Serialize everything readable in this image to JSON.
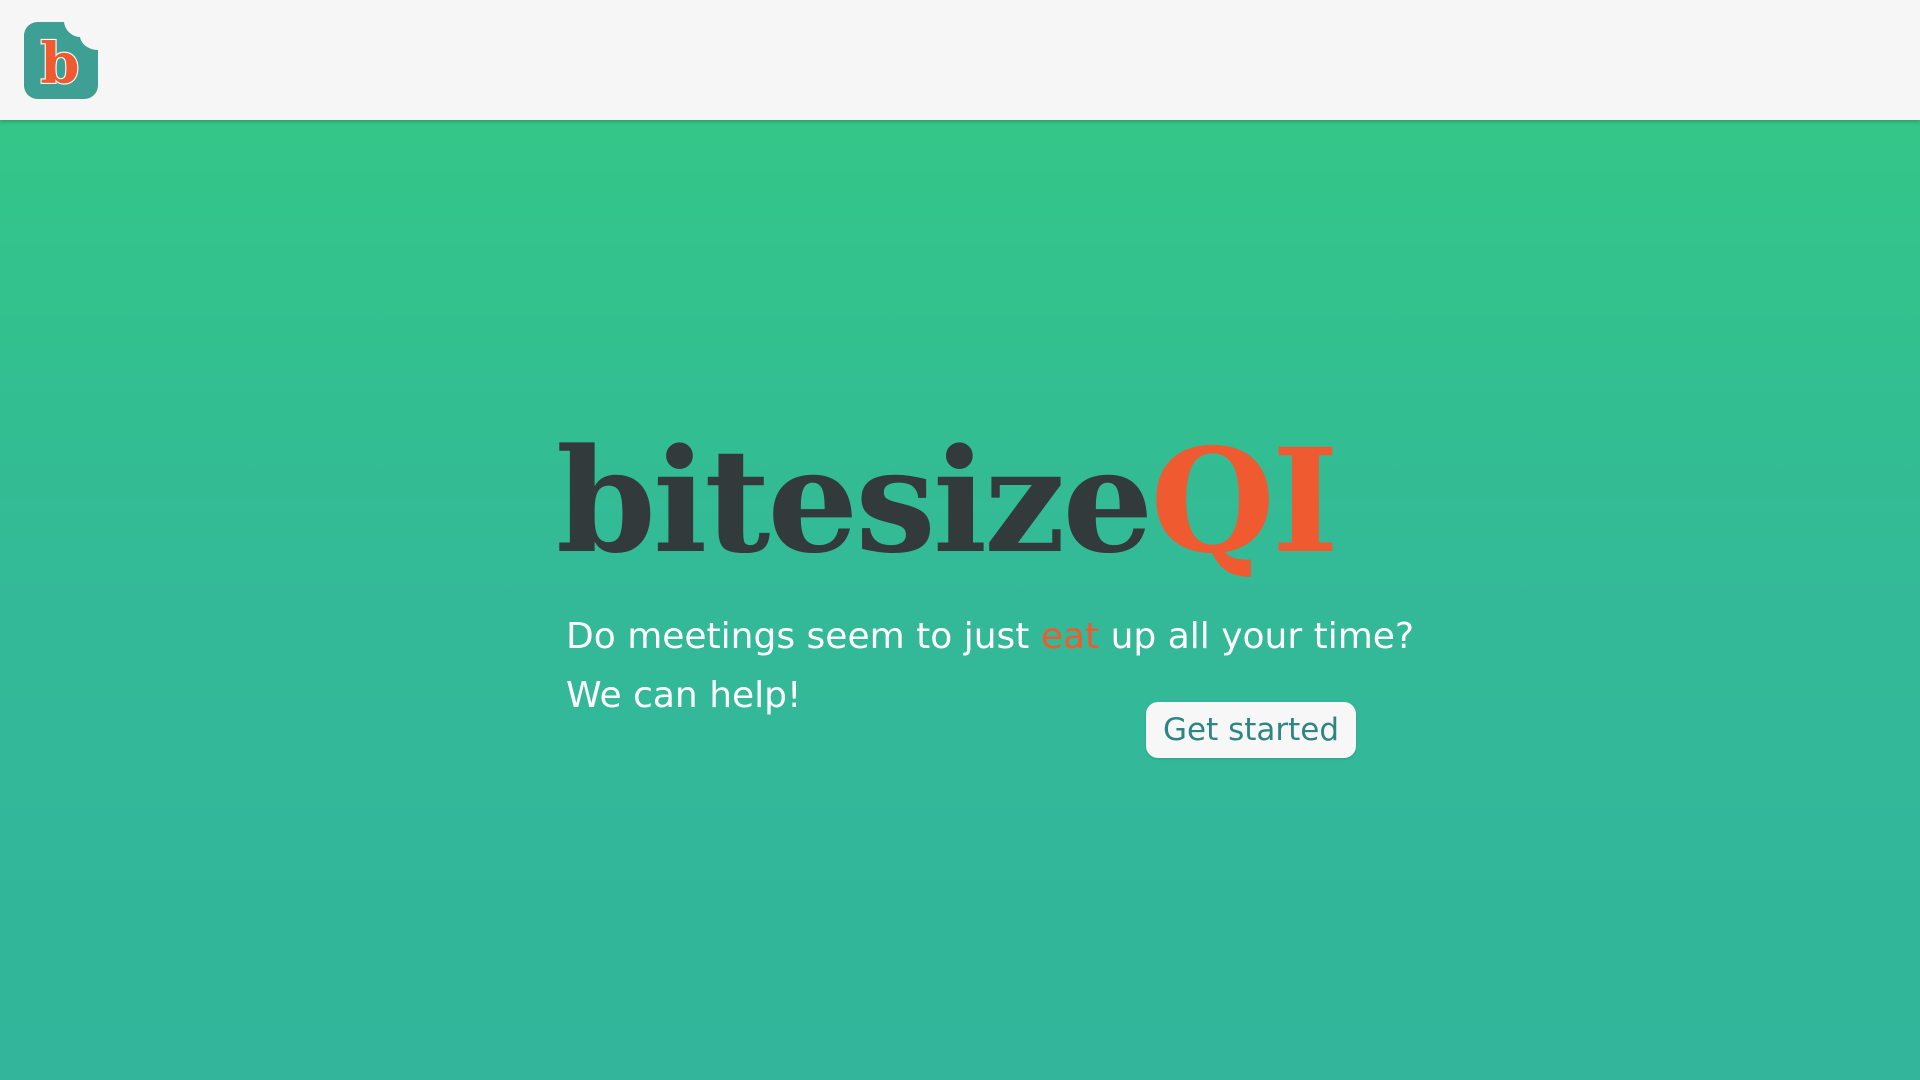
{
  "header": {
    "logo": {
      "icon": "bitten-b-logo-icon",
      "letter": "b",
      "background_color": "#3e9f94",
      "letter_color": "#f05a30"
    }
  },
  "hero": {
    "brand_primary": "bitesize",
    "brand_accent": "QI",
    "tagline_line1_before": "Do meetings seem to just ",
    "tagline_line1_accent": "eat",
    "tagline_line1_after": " up all your time?",
    "tagline_line2": "We can help!",
    "cta_label": "Get started"
  },
  "colors": {
    "header_background": "#f6f6f6",
    "hero_gradient_top": "#33c688",
    "hero_gradient_bottom": "#32b59b",
    "brand_dark": "#333a3c",
    "accent_orange": "#f05a30",
    "tagline_text": "#ffffff",
    "button_background": "#f7f7f7",
    "button_text": "#2f8584"
  }
}
